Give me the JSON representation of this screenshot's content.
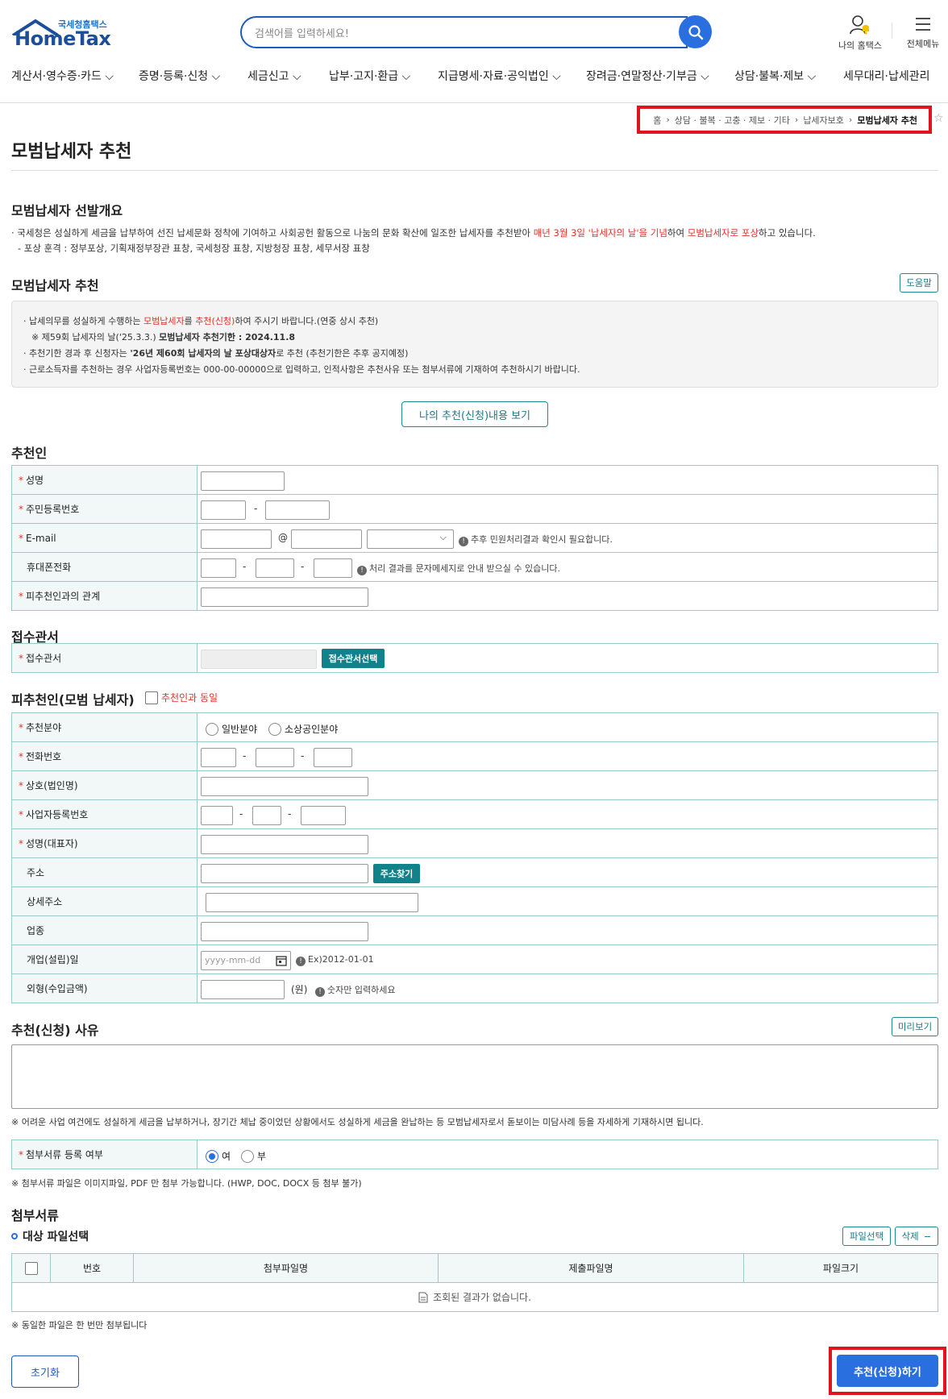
{
  "header": {
    "logo_sub": "국세청홈택스",
    "logo_main": "HomeTax",
    "search_placeholder": "검색어를 입력하세요!",
    "my_hometax": "나의 홈택스",
    "all_menu": "전체메뉴"
  },
  "gnb": [
    "계산서·영수증·카드",
    "증명·등록·신청",
    "세금신고",
    "납부·고지·환급",
    "지급명세·자료·공익법인",
    "장려금·연말정산·기부금",
    "상담·불복·제보",
    "세무대리·납세관리"
  ],
  "breadcrumb": [
    "홈",
    "상담 · 불복 · 고충 · 제보 · 기타",
    "납세자보호",
    "모범납세자 추천"
  ],
  "page_title": "모범납세자 추천",
  "overview": {
    "title": "모범납세자 선발개요",
    "line1_a": "· 국세청은 성실하게 세금을 납부하여 선진 납세문화 정착에 기여하고 사회공헌 활동으로 나눔의 문화 확산에 일조한 납세자를 추천받아 ",
    "line1_red1": "매년 3월 3일 '납세자의 날'을 기념",
    "line1_b": "하여 ",
    "line1_red2": "모범납세자로 포상",
    "line1_c": "하고 있습니다.",
    "line2": "- 포상 훈격 : 정부포상, 기획재정부장관 표창, 국세청장 표창, 지방청장 표창, 세무서장 표창"
  },
  "recommend": {
    "title": "모범납세자 추천",
    "help": "도움말",
    "n1_a": "· 납세의무를 성실하게 수행하는 ",
    "n1_red1": "모범납세자",
    "n1_b": "를 ",
    "n1_red2": "추천(신청)",
    "n1_c": "하여 주시기 바랍니다.(연중 상시 추천)",
    "n2_a": "※ 제59회 납세자의 날('25.3.3.) ",
    "n2_b": "모범납세자 추천기한 : 2024.11.8",
    "n3_a": "· 추천기한 경과 후 신청자는 ",
    "n3_b": "'26년 제60회 납세자의 날 포상대상자",
    "n3_c": "로 추천 (추천기한은 추후 공지예정)",
    "n4": "· 근로소득자를 추천하는 경우 사업자등록번호는 000-00-00000으로 입력하고, 인적사항은 추천사유 또는 첨부서류에 기재하여 추천하시기 바랍니다.",
    "view_btn": "나의 추천(신청)내용 보기"
  },
  "recommender": {
    "title": "추천인",
    "name": "성명",
    "rrn": "주민등록번호",
    "email": "E-mail",
    "at": "@",
    "email_info": "추후 민원처리결과 확인시 필요합니다.",
    "phone": "휴대폰전화",
    "phone_info": "처리 결과를 문자메세지로 안내 받으실 수 있습니다.",
    "relation": "피추천인과의 관계"
  },
  "office": {
    "title": "접수관서",
    "label": "접수관서",
    "btn": "접수관서선택"
  },
  "nominee": {
    "title": "피추천인(모범 납세자)",
    "same": "추천인과 동일",
    "field": "추천분야",
    "opt1": "일반분야",
    "opt2": "소상공인분야",
    "tel": "전화번호",
    "company": "상호(법인명)",
    "bizno": "사업자등록번호",
    "rep": "성명(대표자)",
    "addr": "주소",
    "addr_btn": "주소찾기",
    "addr_detail": "상세주소",
    "industry": "업종",
    "opendate": "개업(설립)일",
    "date_ph": "yyyy-mm-dd",
    "date_info": "Ex)2012-01-01",
    "revenue": "외형(수입금액)",
    "won": "(원)",
    "rev_info": "숫자만 입력하세요"
  },
  "reason": {
    "title": "추천(신청) 사유",
    "preview": "미리보기",
    "note": "※ 어려운 사업 여건에도 성실하게 세금을 납부하거나, 장기간 체납 중이었던 상황에서도 성실하게 세금을 완납하는 등 모범납세자로서 돋보이는 미담사례 등을 자세하게 기재하시면 됩니다."
  },
  "attach_reg": {
    "label": "첨부서류 등록 여부",
    "yes": "여",
    "no": "부",
    "note": "※ 첨부서류 파일은 이미지파일, PDF 만 첨부 가능합니다. (HWP, DOC, DOCX 등 첨부 불가)"
  },
  "attach": {
    "title": "첨부서류",
    "sub": "대상 파일선택",
    "file_btn": "파일선택",
    "del_btn": "삭제",
    "cols": [
      "번호",
      "첨부파일명",
      "제출파일명",
      "파일크기"
    ],
    "empty": "조회된 결과가 없습니다.",
    "note": "※ 동일한 파일은 한 번만 첨부됩니다"
  },
  "actions": {
    "reset": "초기화",
    "submit": "추천(신청)하기"
  }
}
